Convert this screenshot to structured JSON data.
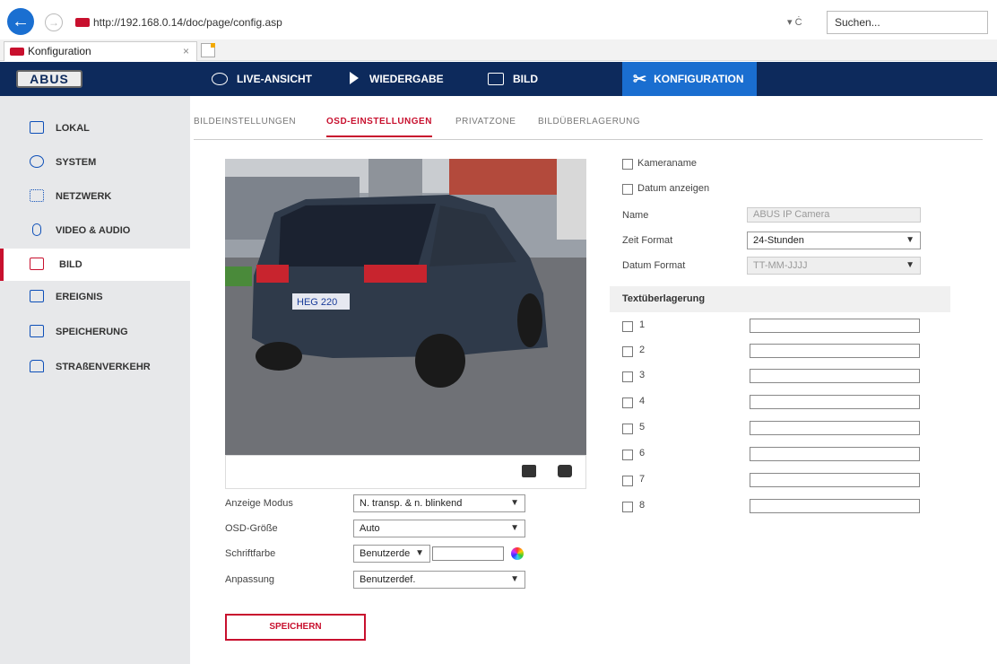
{
  "browser": {
    "url": "http://192.168.0.14/doc/page/config.asp",
    "url_controls": "▾ Ċ",
    "search_placeholder": "Suchen...",
    "tab_title": "Konfiguration",
    "tab_close": "×"
  },
  "header": {
    "logo": "ABUS",
    "nav": [
      {
        "label": "LIVE-ANSICHT",
        "icon": "eye-icon"
      },
      {
        "label": "WIEDERGABE",
        "icon": "play-icon"
      },
      {
        "label": "BILD",
        "icon": "image-icon"
      },
      {
        "label": "KONFIGURATION",
        "icon": "tools-icon",
        "active": true
      }
    ]
  },
  "sidebar": {
    "items": [
      {
        "label": "LOKAL",
        "icon": "monitor-icon"
      },
      {
        "label": "SYSTEM",
        "icon": "gear-icon"
      },
      {
        "label": "NETZWERK",
        "icon": "network-icon"
      },
      {
        "label": "VIDEO & AUDIO",
        "icon": "microphone-icon"
      },
      {
        "label": "BILD",
        "icon": "image-icon",
        "active": true
      },
      {
        "label": "EREIGNIS",
        "icon": "calendar-icon"
      },
      {
        "label": "SPEICHERUNG",
        "icon": "storage-icon"
      },
      {
        "label": "STRAßENVERKEHR",
        "icon": "car-icon"
      }
    ]
  },
  "subtabs": [
    {
      "label": "BILDEINSTELLUNGEN"
    },
    {
      "label": "OSD-EINSTELLUNGEN",
      "active": true
    },
    {
      "label": "PRIVATZONE"
    },
    {
      "label": "BILDÜBERLAGERUNG"
    }
  ],
  "preview": {
    "plate": "HEG 220"
  },
  "left_form": {
    "display_mode_label": "Anzeige Modus",
    "display_mode_value": "N. transp. & n. blinkend",
    "osd_size_label": "OSD-Größe",
    "osd_size_value": "Auto",
    "font_color_label": "Schriftfarbe",
    "font_color_value": "Benutzerde",
    "alignment_label": "Anpassung",
    "alignment_value": "Benutzerdef."
  },
  "save_label": "SPEICHERN",
  "right_form": {
    "camera_name_label": "Kameraname",
    "show_date_label": "Datum anzeigen",
    "name_label": "Name",
    "name_value": "ABUS IP Camera",
    "time_format_label": "Zeit Format",
    "time_format_value": "24-Stunden",
    "date_format_label": "Datum Format",
    "date_format_value": "TT-MM-JJJJ",
    "overlay_header": "Textüberlagerung",
    "overlay_rows": [
      "1",
      "2",
      "3",
      "4",
      "5",
      "6",
      "7",
      "8"
    ]
  },
  "colors": {
    "accent": "#c8102e",
    "nav_bg": "#0d2a5c",
    "nav_active": "#1a6ed0",
    "sidebar_bg": "#e7e8ea"
  }
}
